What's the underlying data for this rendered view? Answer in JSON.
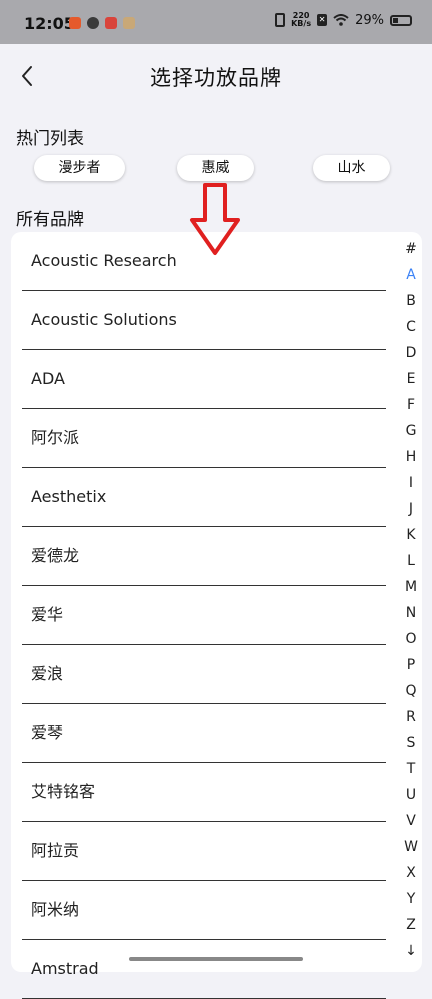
{
  "status": {
    "time": "12:05",
    "net_speed_top": "220",
    "net_speed_bottom": "KB/s",
    "battery": "29%",
    "battery_level": 0.29,
    "app_icon_colors": [
      "#e55a2b",
      "#3a3a3a",
      "#d9443b",
      "#c9a877"
    ]
  },
  "header": {
    "title": "选择功放品牌",
    "back_icon": "back-chevron-icon"
  },
  "hot": {
    "title": "热门列表",
    "chips": [
      "漫步者",
      "惠威",
      "山水"
    ]
  },
  "all": {
    "title": "所有品牌"
  },
  "brands": [
    "Acoustic Research",
    "Acoustic Solutions",
    "ADA",
    "阿尔派",
    "Aesthetix",
    "爱德龙",
    "爱华",
    "爱浪",
    "爱琴",
    "艾特铭客",
    "阿拉贡",
    "阿米纳",
    "Amstrad"
  ],
  "index": {
    "letters": [
      "#",
      "A",
      "B",
      "C",
      "D",
      "E",
      "F",
      "G",
      "H",
      "I",
      "J",
      "K",
      "L",
      "M",
      "N",
      "O",
      "P",
      "Q",
      "R",
      "S",
      "T",
      "U",
      "V",
      "W",
      "X",
      "Y",
      "Z",
      "↓"
    ],
    "active": "A"
  },
  "colors": {
    "accent": "#3b82f6",
    "annotation_arrow": "#e02020"
  }
}
